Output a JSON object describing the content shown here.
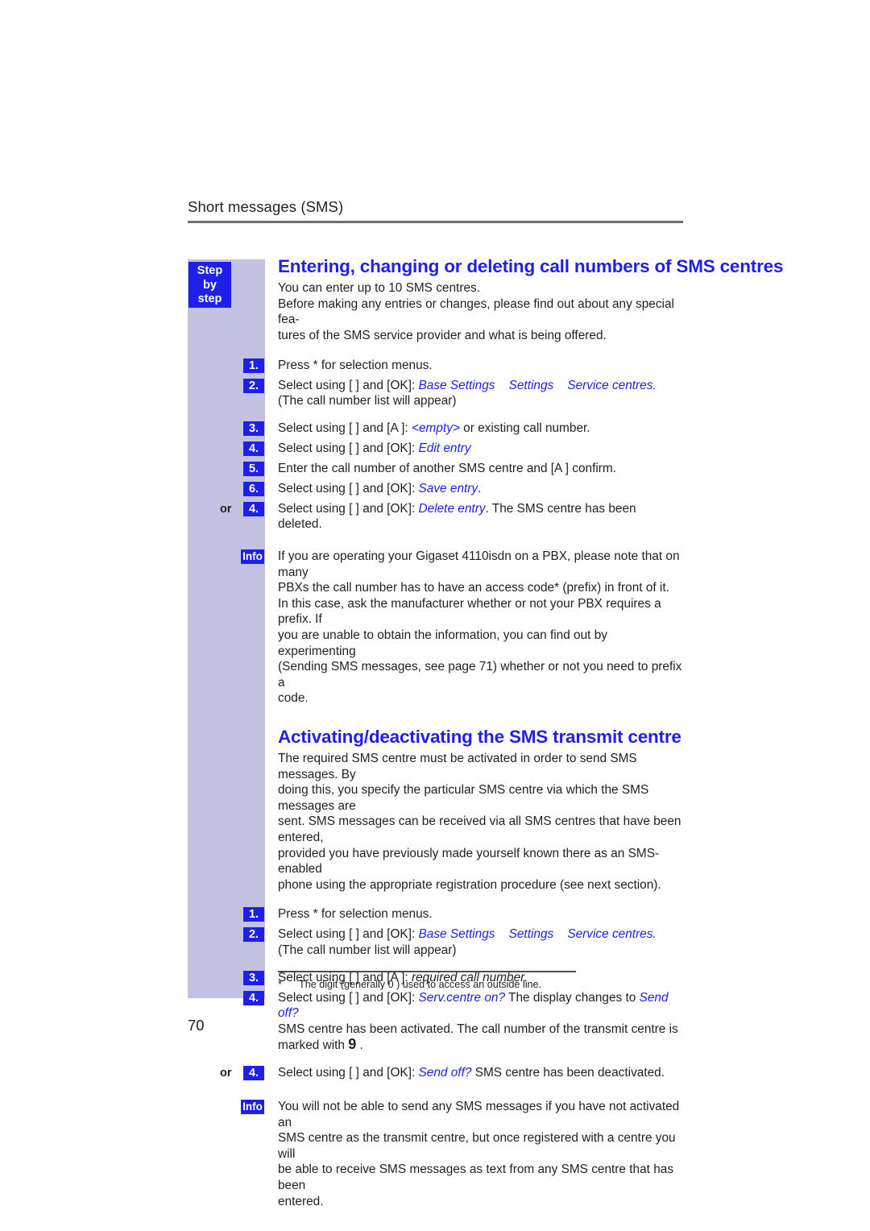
{
  "header": {
    "running_title": "Short messages (SMS)"
  },
  "sidebar": {
    "flag": {
      "line1": "Step",
      "line2": "by",
      "line3": "step"
    },
    "info_badge_label": "Info",
    "or_label": "or"
  },
  "page_number": "70",
  "sections": [
    {
      "title": "Entering, changing or deleting call numbers of SMS centres",
      "intro": [
        "You can enter up to 10 SMS centres.",
        "Before making any entries or changes, please find out about any special fea-",
        "tures of the SMS service provider and what is being offered."
      ],
      "steps": [
        {
          "badge": "1.",
          "prefix": "",
          "text_lead": "Press * ",
          "text_rest": "for selection menus."
        },
        {
          "badge": "2.",
          "text_lead": "Select using [   ] and [OK]: ",
          "display": [
            "Base Settings",
            "Settings",
            "Service centres."
          ],
          "continuation": "(The call number list will appear)"
        },
        {
          "badge": "3.",
          "text_lead": "Select using [   ] and [A  ]: ",
          "display_single": "<empty>",
          "text_tail": " or existing call number."
        },
        {
          "badge": "4.",
          "text_lead": "Select using [   ] and [OK]: ",
          "display_single": "Edit entry",
          "text_tail": ""
        },
        {
          "badge": "5.",
          "text_lead": "Enter the call number of another SMS centre and [A  ] confirm.",
          "text_tail": ""
        },
        {
          "badge": "6.",
          "text_lead": "Select using [   ] and [OK]: ",
          "display_single": "Save entry",
          "text_tail": "."
        },
        {
          "badge": "4.",
          "or": true,
          "text_lead": "Select using [   ] and [OK]: ",
          "display_single": "Delete entry",
          "text_tail": ". The SMS centre has been deleted."
        }
      ],
      "info": [
        "If you are operating your Gigaset 4110isdn on a PBX, please note that on many",
        "PBXs the call number has to have an access code* (prefix) in front of it.",
        "In this case, ask the manufacturer whether or not your PBX requires a prefix. If",
        "you are unable to obtain the information, you can find out by experimenting",
        "(Sending SMS messages, see page 71) whether or not you need to prefix a",
        "code."
      ]
    },
    {
      "title": "Activating/deactivating the SMS transmit centre",
      "intro": [
        "The required SMS centre must be activated in order to send SMS messages. By",
        "doing this, you specify the particular SMS centre via which the SMS messages are",
        "sent. SMS messages can be received via all SMS centres that have been entered,",
        "provided you have previously made yourself known there as an SMS-enabled",
        "phone using the appropriate registration procedure (see next section)."
      ],
      "steps": [
        {
          "badge": "1.",
          "text_lead": "Press * ",
          "text_rest": "for selection menus."
        },
        {
          "badge": "2.",
          "text_lead": "Select using [   ] and [OK]: ",
          "display": [
            "Base Settings",
            "Settings",
            "Service centres."
          ],
          "continuation": "(The call number list will appear)"
        },
        {
          "badge": "3.",
          "text_lead": "Select using [   ] and [A  ]: ",
          "italic_single": "required call number."
        },
        {
          "badge": "4.",
          "text_lead": "Select using [   ] and [OK]: ",
          "display_single": "Serv.centre on?",
          "mid_text": " The display changes to ",
          "display_second": "Send off?",
          "cont1": "SMS centre has been activated. The call number of the transmit centre is",
          "cont2_lead": "marked with ",
          "cont2_digit": "9",
          "cont2_tail": " ."
        },
        {
          "badge": "4.",
          "or": true,
          "text_lead": "Select using [   ] and [OK]: ",
          "display_single": "Send off?",
          "text_tail": " SMS centre has been deactivated."
        }
      ],
      "info": [
        "You will not be able to send any SMS messages if you have not activated an",
        "SMS centre as the transmit centre, but once registered with a centre you will",
        "be able to receive SMS messages as text from any SMS centre that has been",
        "entered."
      ]
    }
  ],
  "footnote": {
    "marker": "*",
    "text": "The digit (generally  0  ) used to access an outside line."
  },
  "colors": {
    "accent_blue": "#1f1fec",
    "band_lavender": "#c3c2e3",
    "text": "#231f20"
  }
}
